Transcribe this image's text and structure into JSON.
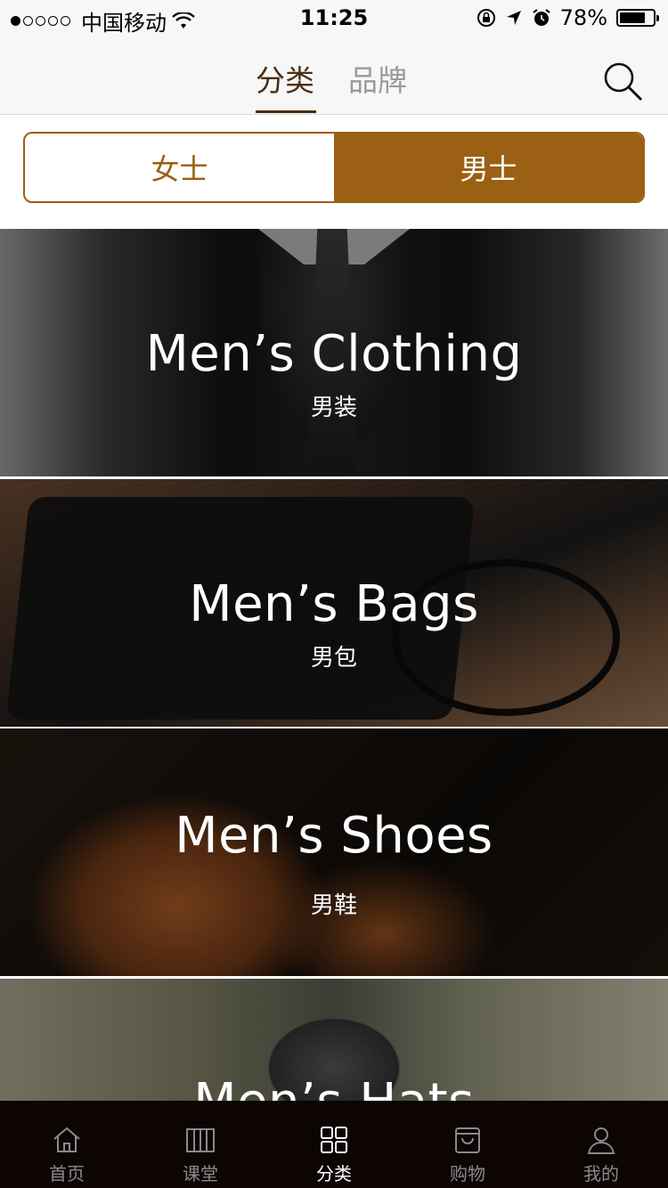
{
  "status_bar": {
    "carrier": "中国移动",
    "time": "11:25",
    "battery": "78%",
    "battery_level": 0.78,
    "signal_dots_filled": 1
  },
  "header": {
    "tabs": [
      {
        "label": "分类",
        "active": true
      },
      {
        "label": "品牌",
        "active": false
      }
    ],
    "search_icon": "search-icon"
  },
  "gender_toggle": {
    "women": "女士",
    "men": "男士",
    "selected": "men"
  },
  "categories": [
    {
      "title": "Men’s Clothing",
      "subtitle": "男装"
    },
    {
      "title": "Men’s Bags",
      "subtitle": "男包"
    },
    {
      "title": "Men’s Shoes",
      "subtitle": "男鞋"
    },
    {
      "title": "Men’s Hats",
      "subtitle": ""
    }
  ],
  "tab_bar": [
    {
      "label": "首页",
      "icon": "home-icon",
      "active": false
    },
    {
      "label": "课堂",
      "icon": "book-icon",
      "active": false
    },
    {
      "label": "分类",
      "icon": "grid-icon",
      "active": true
    },
    {
      "label": "购物",
      "icon": "bag-icon",
      "active": false
    },
    {
      "label": "我的",
      "icon": "profile-icon",
      "active": false
    }
  ],
  "colors": {
    "accent": "#9b6014",
    "header_text": "#4a2e12",
    "tabbar_bg": "#0d0404"
  }
}
